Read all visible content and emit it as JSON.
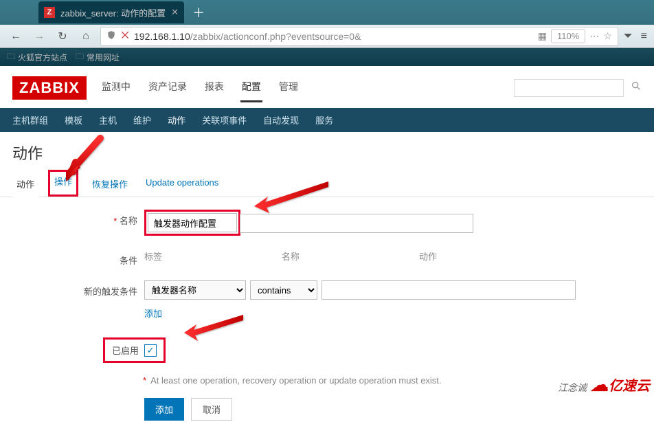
{
  "browser": {
    "tab_title": "zabbix_server: 动作的配置",
    "tab_favicon": "Z",
    "url_host": "192.168.1.10",
    "url_path": "/zabbix/actionconf.php?eventsource=0&",
    "zoom": "110%",
    "bookmarks": [
      {
        "label": "火狐官方站点"
      },
      {
        "label": "常用网址"
      }
    ]
  },
  "zabbix": {
    "logo": "ZABBIX",
    "nav": [
      {
        "label": "监测中",
        "active": false
      },
      {
        "label": "资产记录",
        "active": false
      },
      {
        "label": "报表",
        "active": false
      },
      {
        "label": "配置",
        "active": true
      },
      {
        "label": "管理",
        "active": false
      }
    ],
    "subnav": [
      {
        "label": "主机群组"
      },
      {
        "label": "模板"
      },
      {
        "label": "主机"
      },
      {
        "label": "维护"
      },
      {
        "label": "动作",
        "active": true
      },
      {
        "label": "关联项事件"
      },
      {
        "label": "自动发现"
      },
      {
        "label": "服务"
      }
    ],
    "page_title": "动作",
    "tabs": [
      {
        "label": "动作"
      },
      {
        "label": "操作",
        "highlight": true
      },
      {
        "label": "恢复操作"
      },
      {
        "label": "Update operations"
      }
    ],
    "form": {
      "name_label": "名称",
      "name_value": "触发器动作配置",
      "condition_label": "条件",
      "condition_cols": {
        "c1": "标签",
        "c2": "名称",
        "c3": "动作"
      },
      "trigger_label": "新的触发条件",
      "trigger_select1": "触发器名称",
      "trigger_select2": "contains",
      "trigger_value": "",
      "add_link": "添加",
      "enabled_label": "已启用",
      "enabled_checked": true,
      "note": "At least one operation, recovery operation or update operation must exist.",
      "btn_add": "添加",
      "btn_cancel": "取消"
    }
  },
  "watermark": {
    "author": "江念诚",
    "brand": "亿速云"
  }
}
